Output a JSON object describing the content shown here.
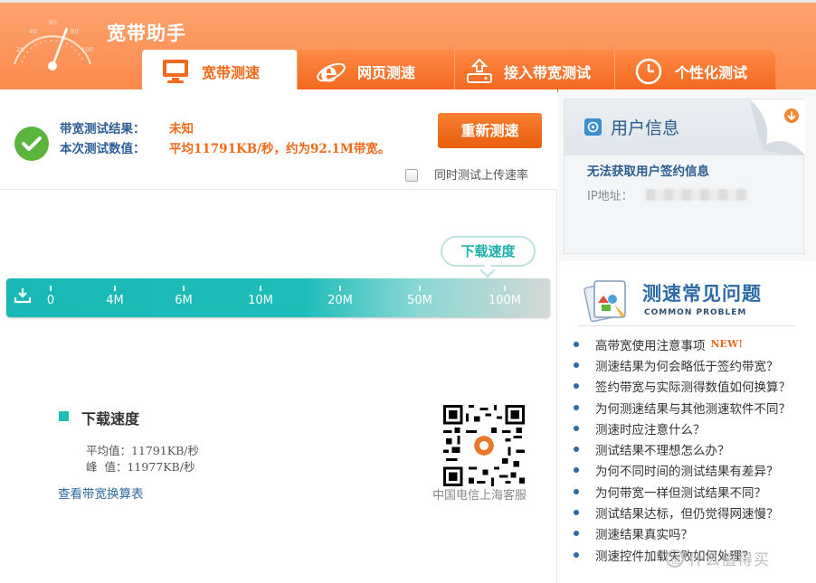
{
  "header": {
    "app_title": "宽带助手",
    "tabs": [
      {
        "label": "宽带测速",
        "icon": "monitor-icon",
        "active": true
      },
      {
        "label": "网页测速",
        "icon": "ie-browser-icon",
        "active": false
      },
      {
        "label": "接入带宽测试",
        "icon": "router-icon",
        "active": false
      },
      {
        "label": "个性化测试",
        "icon": "clock-icon",
        "active": false
      }
    ]
  },
  "result": {
    "bandwidth_label": "带宽测试结果：",
    "bandwidth_value": "未知",
    "measured_label": "本次测试数值：",
    "measured_value": "平均11791KB/秒，约为92.1M带宽。",
    "retest_button": "重新测速",
    "upload_checkbox_label": "同时测试上传速率",
    "upload_checked": false
  },
  "speed_meter": {
    "bubble_label": "下载速度",
    "ticks": [
      "0",
      "4M",
      "6M",
      "10M",
      "20M",
      "50M",
      "100M"
    ]
  },
  "download": {
    "title": "下载速度",
    "average": "平均值：11791KB/秒",
    "peak": "峰  值：11977KB/秒",
    "convert_link": "查看带宽换算表"
  },
  "qr": {
    "caption": "中国电信上海客服"
  },
  "user_info": {
    "title": "用户信息",
    "message": "无法获取用户签约信息",
    "ip_label": "IP地址："
  },
  "faq": {
    "title": "测速常见问题",
    "subtitle": "COMMON PROBLEM",
    "new_badge": "NEW!",
    "items": [
      "高带宽使用注意事项",
      "测速结果为何会略低于签约带宽？",
      "签约带宽与实际测得数值如何换算？",
      "为何测速结果与其他测速软件不同？",
      "测速时应注意什么？",
      "测试结果不理想怎么办？",
      "为何不同时间的测试结果有差异？",
      "为何带宽一样但测试结果不同？",
      "测试结果达标，但仍觉得网速慢？",
      "测速结果真实吗？",
      "测速控件加载失败如何处理？"
    ]
  },
  "watermark": "什么值得买",
  "colors": {
    "header_orange": "#fb8b4c",
    "accent_orange": "#f06a1a",
    "teal": "#1fbdba",
    "link_blue": "#2b6aa6",
    "success_green": "#5bb53c"
  }
}
